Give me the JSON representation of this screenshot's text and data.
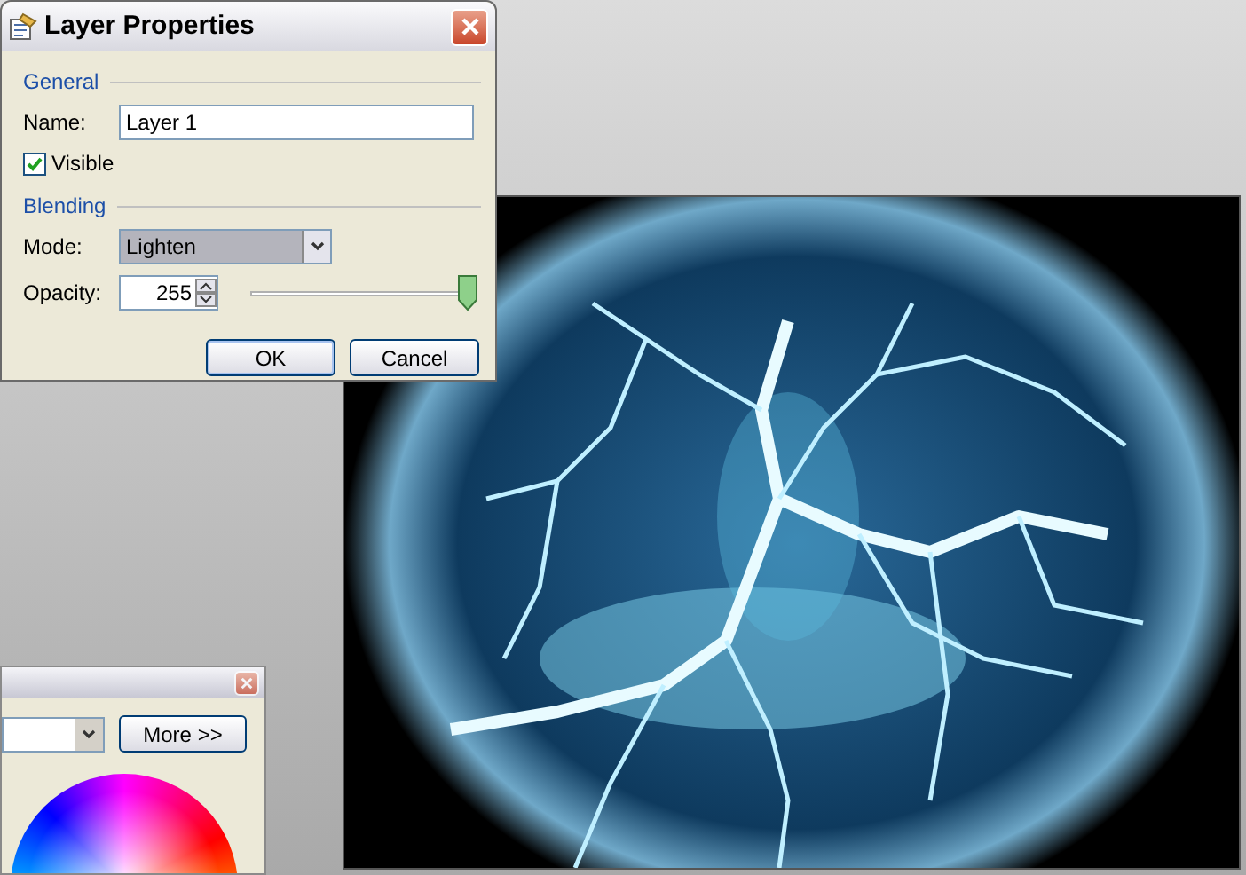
{
  "dialog": {
    "title": "Layer Properties",
    "general": {
      "heading": "General",
      "name_label": "Name:",
      "name_value": "Layer 1",
      "visible": {
        "label": "Visible",
        "checked": true
      }
    },
    "blending": {
      "heading": "Blending",
      "mode_label": "Mode:",
      "mode_value": "Lighten",
      "opacity_label": "Opacity:",
      "opacity_value": "255",
      "opacity_slider": {
        "level": 1
      }
    },
    "buttons": [
      {
        "label": "OK",
        "default": true
      },
      {
        "label": "Cancel",
        "default": false
      }
    ]
  },
  "colors_window": {
    "more_button": "More >>"
  }
}
